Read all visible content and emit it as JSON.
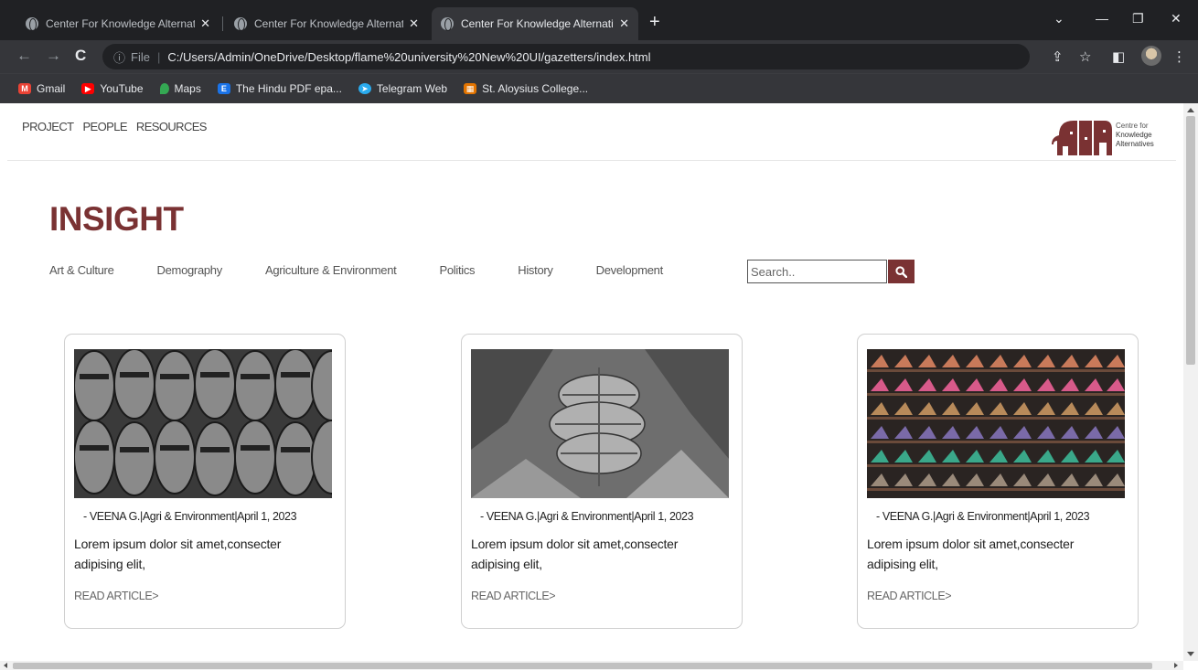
{
  "browser": {
    "tabs": [
      {
        "title": "Center For Knowledge Alternative",
        "active": false
      },
      {
        "title": "Center For Knowledge Alternative",
        "active": false
      },
      {
        "title": "Center For Knowledge Alternative",
        "active": true
      }
    ],
    "address": {
      "scheme": "File",
      "url": "C:/Users/Admin/OneDrive/Desktop/flame%20university%20New%20UI/gazetters/index.html"
    },
    "bookmarks": [
      {
        "label": "Gmail",
        "icon": "gmail-icon",
        "color": "#ea4335"
      },
      {
        "label": "YouTube",
        "icon": "youtube-icon",
        "color": "#ff0000"
      },
      {
        "label": "Maps",
        "icon": "maps-icon",
        "color": "#34a853"
      },
      {
        "label": "The Hindu PDF epa...",
        "icon": "e-icon",
        "color": "#1a73e8"
      },
      {
        "label": "Telegram Web",
        "icon": "telegram-icon",
        "color": "#2aabee"
      },
      {
        "label": "St. Aloysius College...",
        "icon": "college-icon",
        "color": "#e37400"
      }
    ]
  },
  "site": {
    "nav": [
      {
        "label": "PROJECT"
      },
      {
        "label": "PEOPLE"
      },
      {
        "label": "RESOURCES"
      }
    ],
    "logo": {
      "line1": "Centre for",
      "line2": "Knowledge",
      "line3": "Alternatives",
      "color": "#7a3233"
    }
  },
  "main": {
    "title": "INSIGHT",
    "accent": "#7a3233",
    "categories": [
      {
        "label": "Art & Culture"
      },
      {
        "label": "Demography"
      },
      {
        "label": "Agriculture & Environment"
      },
      {
        "label": "Politics"
      },
      {
        "label": "History"
      },
      {
        "label": "Development"
      }
    ],
    "search": {
      "placeholder": "Search.."
    },
    "articles": [
      {
        "meta": "- VEENA G.|Agri & Environment|April 1, 2023",
        "excerpt": "Lorem ipsum dolor sit amet,consecter adipising elit,",
        "read_more": "READ ARTICLE>",
        "image": "sandals-photo"
      },
      {
        "meta": "- VEENA G.|Agri & Environment|April 1, 2023",
        "excerpt": "Lorem ipsum dolor sit amet,consecter adipising elit,",
        "read_more": "READ ARTICLE>",
        "image": "bananas-photo"
      },
      {
        "meta": "- VEENA G.|Agri & Environment|April 1, 2023",
        "excerpt": "Lorem ipsum dolor sit amet,consecter adipising elit,",
        "read_more": "READ ARTICLE>",
        "image": "shoes-shelf-photo"
      }
    ]
  }
}
